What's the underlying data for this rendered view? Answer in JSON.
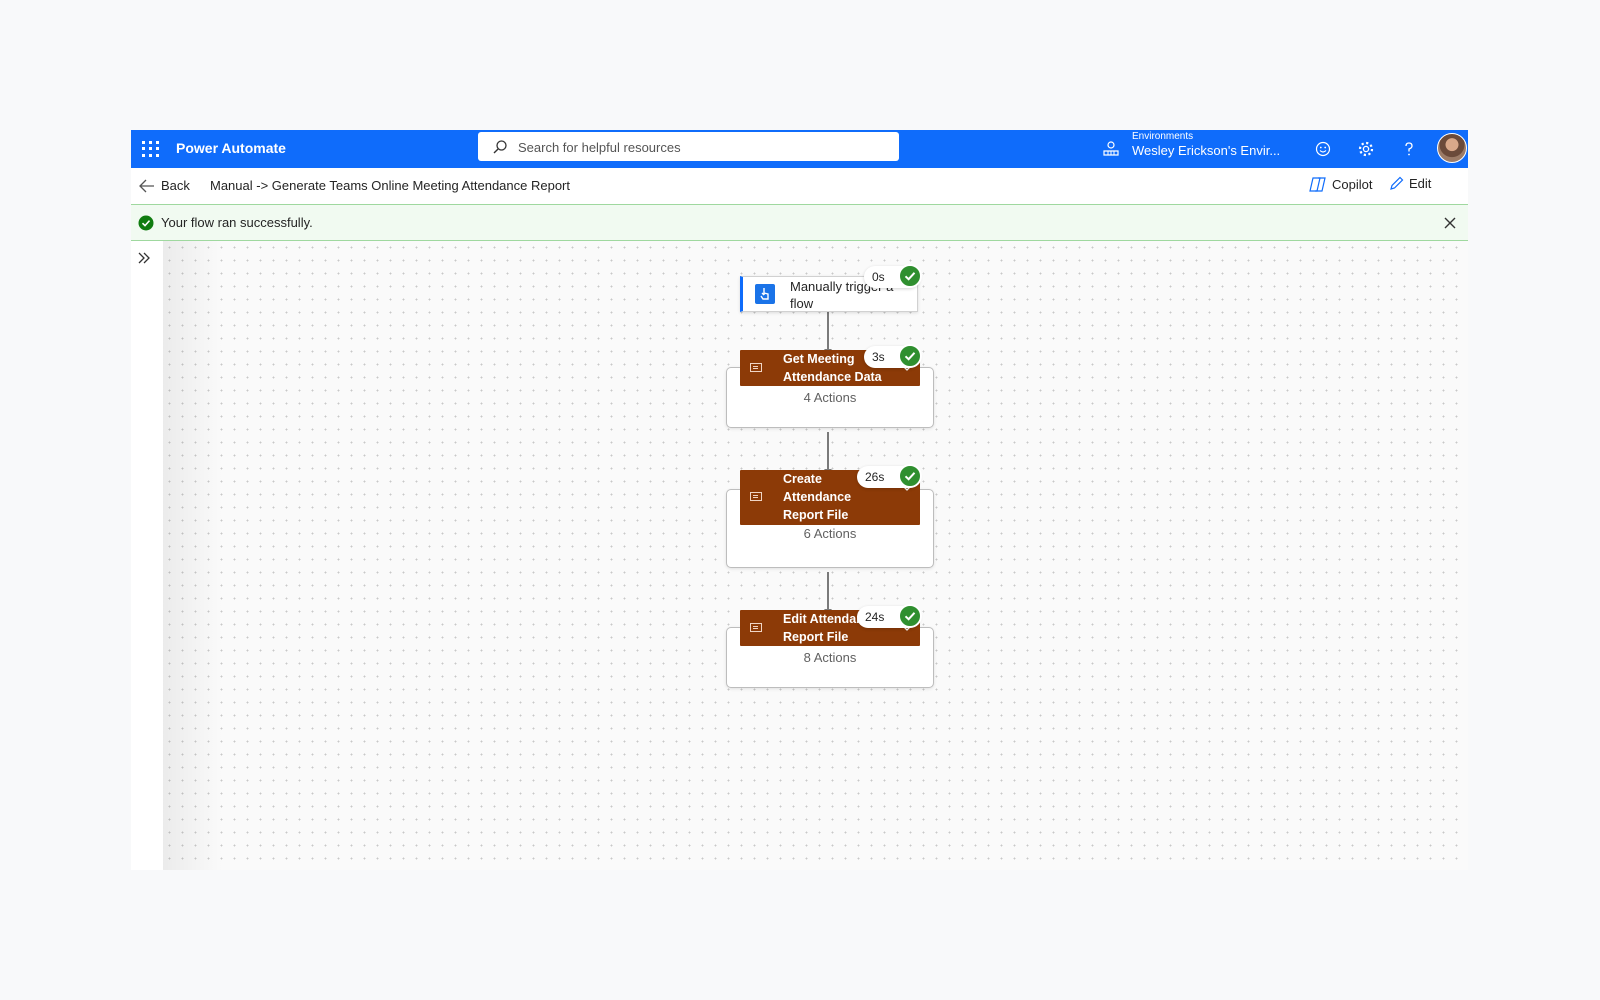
{
  "header": {
    "app_name": "Power Automate",
    "search_placeholder": "Search for helpful resources",
    "env_label": "Environments",
    "env_name": "Wesley Erickson's Envir...",
    "icons": [
      "waffle-icon",
      "search-icon",
      "environment-icon",
      "smiley-icon",
      "gear-icon",
      "help-icon",
      "avatar"
    ]
  },
  "command_bar": {
    "back_label": "Back",
    "flow_title": "Manual -> Generate Teams Online Meeting Attendance Report",
    "copilot_label": "Copilot",
    "edit_label": "Edit"
  },
  "banner": {
    "message": "Your flow ran successfully.",
    "color": "#f1faf1"
  },
  "flow": {
    "trigger": {
      "label": "Manually trigger a flow",
      "duration": "0s",
      "status": "succeeded"
    },
    "scopes": [
      {
        "title": "Get Meeting Attendance Data",
        "actions": "4 Actions",
        "duration": "3s",
        "status": "succeeded"
      },
      {
        "title": "Create Attendance Report File",
        "actions": "6 Actions",
        "duration": "26s",
        "status": "succeeded"
      },
      {
        "title": "Edit Attendance Report File",
        "actions": "8 Actions",
        "duration": "24s",
        "status": "succeeded"
      }
    ]
  },
  "colors": {
    "brand": "#0f6cfb",
    "scope_header": "#8c3a07",
    "success": "#2f8f2f"
  }
}
